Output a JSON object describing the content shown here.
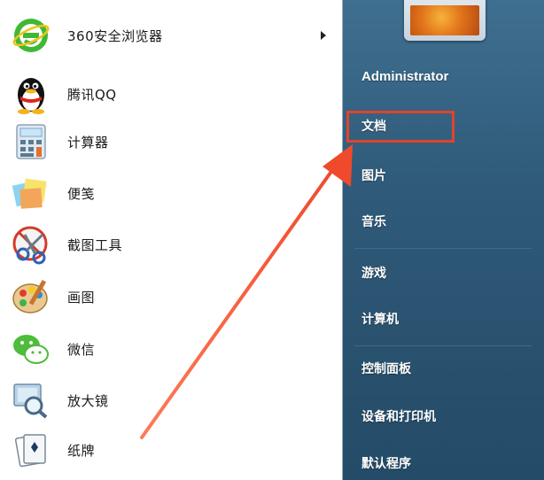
{
  "programs": [
    {
      "label": "360安全浏览器",
      "icon": "360-browser-icon",
      "has_submenu": true
    },
    {
      "label": "腾讯QQ",
      "icon": "qq-penguin-icon",
      "has_submenu": false
    },
    {
      "label": "计算器",
      "icon": "calculator-icon",
      "has_submenu": false
    },
    {
      "label": "便笺",
      "icon": "sticky-notes-icon",
      "has_submenu": false
    },
    {
      "label": "截图工具",
      "icon": "scissors-icon",
      "has_submenu": false
    },
    {
      "label": "画图",
      "icon": "paint-palette-icon",
      "has_submenu": false
    },
    {
      "label": "微信",
      "icon": "wechat-icon",
      "has_submenu": false
    },
    {
      "label": "放大镜",
      "icon": "magnifier-icon",
      "has_submenu": false
    },
    {
      "label": "纸牌",
      "icon": "solitaire-cards-icon",
      "has_submenu": false
    }
  ],
  "user": {
    "name": "Administrator",
    "avatar": "user-avatar-icon"
  },
  "links": [
    {
      "label": "文档",
      "highlighted": true
    },
    {
      "label": "图片"
    },
    {
      "label": "音乐"
    },
    {
      "label": "游戏"
    },
    {
      "label": "计算机"
    },
    {
      "label": "控制面板"
    },
    {
      "label": "设备和打印机"
    },
    {
      "label": "默认程序"
    }
  ],
  "colors": {
    "highlight": "#e0442a",
    "panel_bg": "#ffffff",
    "right_bg": "#2f5a79"
  }
}
